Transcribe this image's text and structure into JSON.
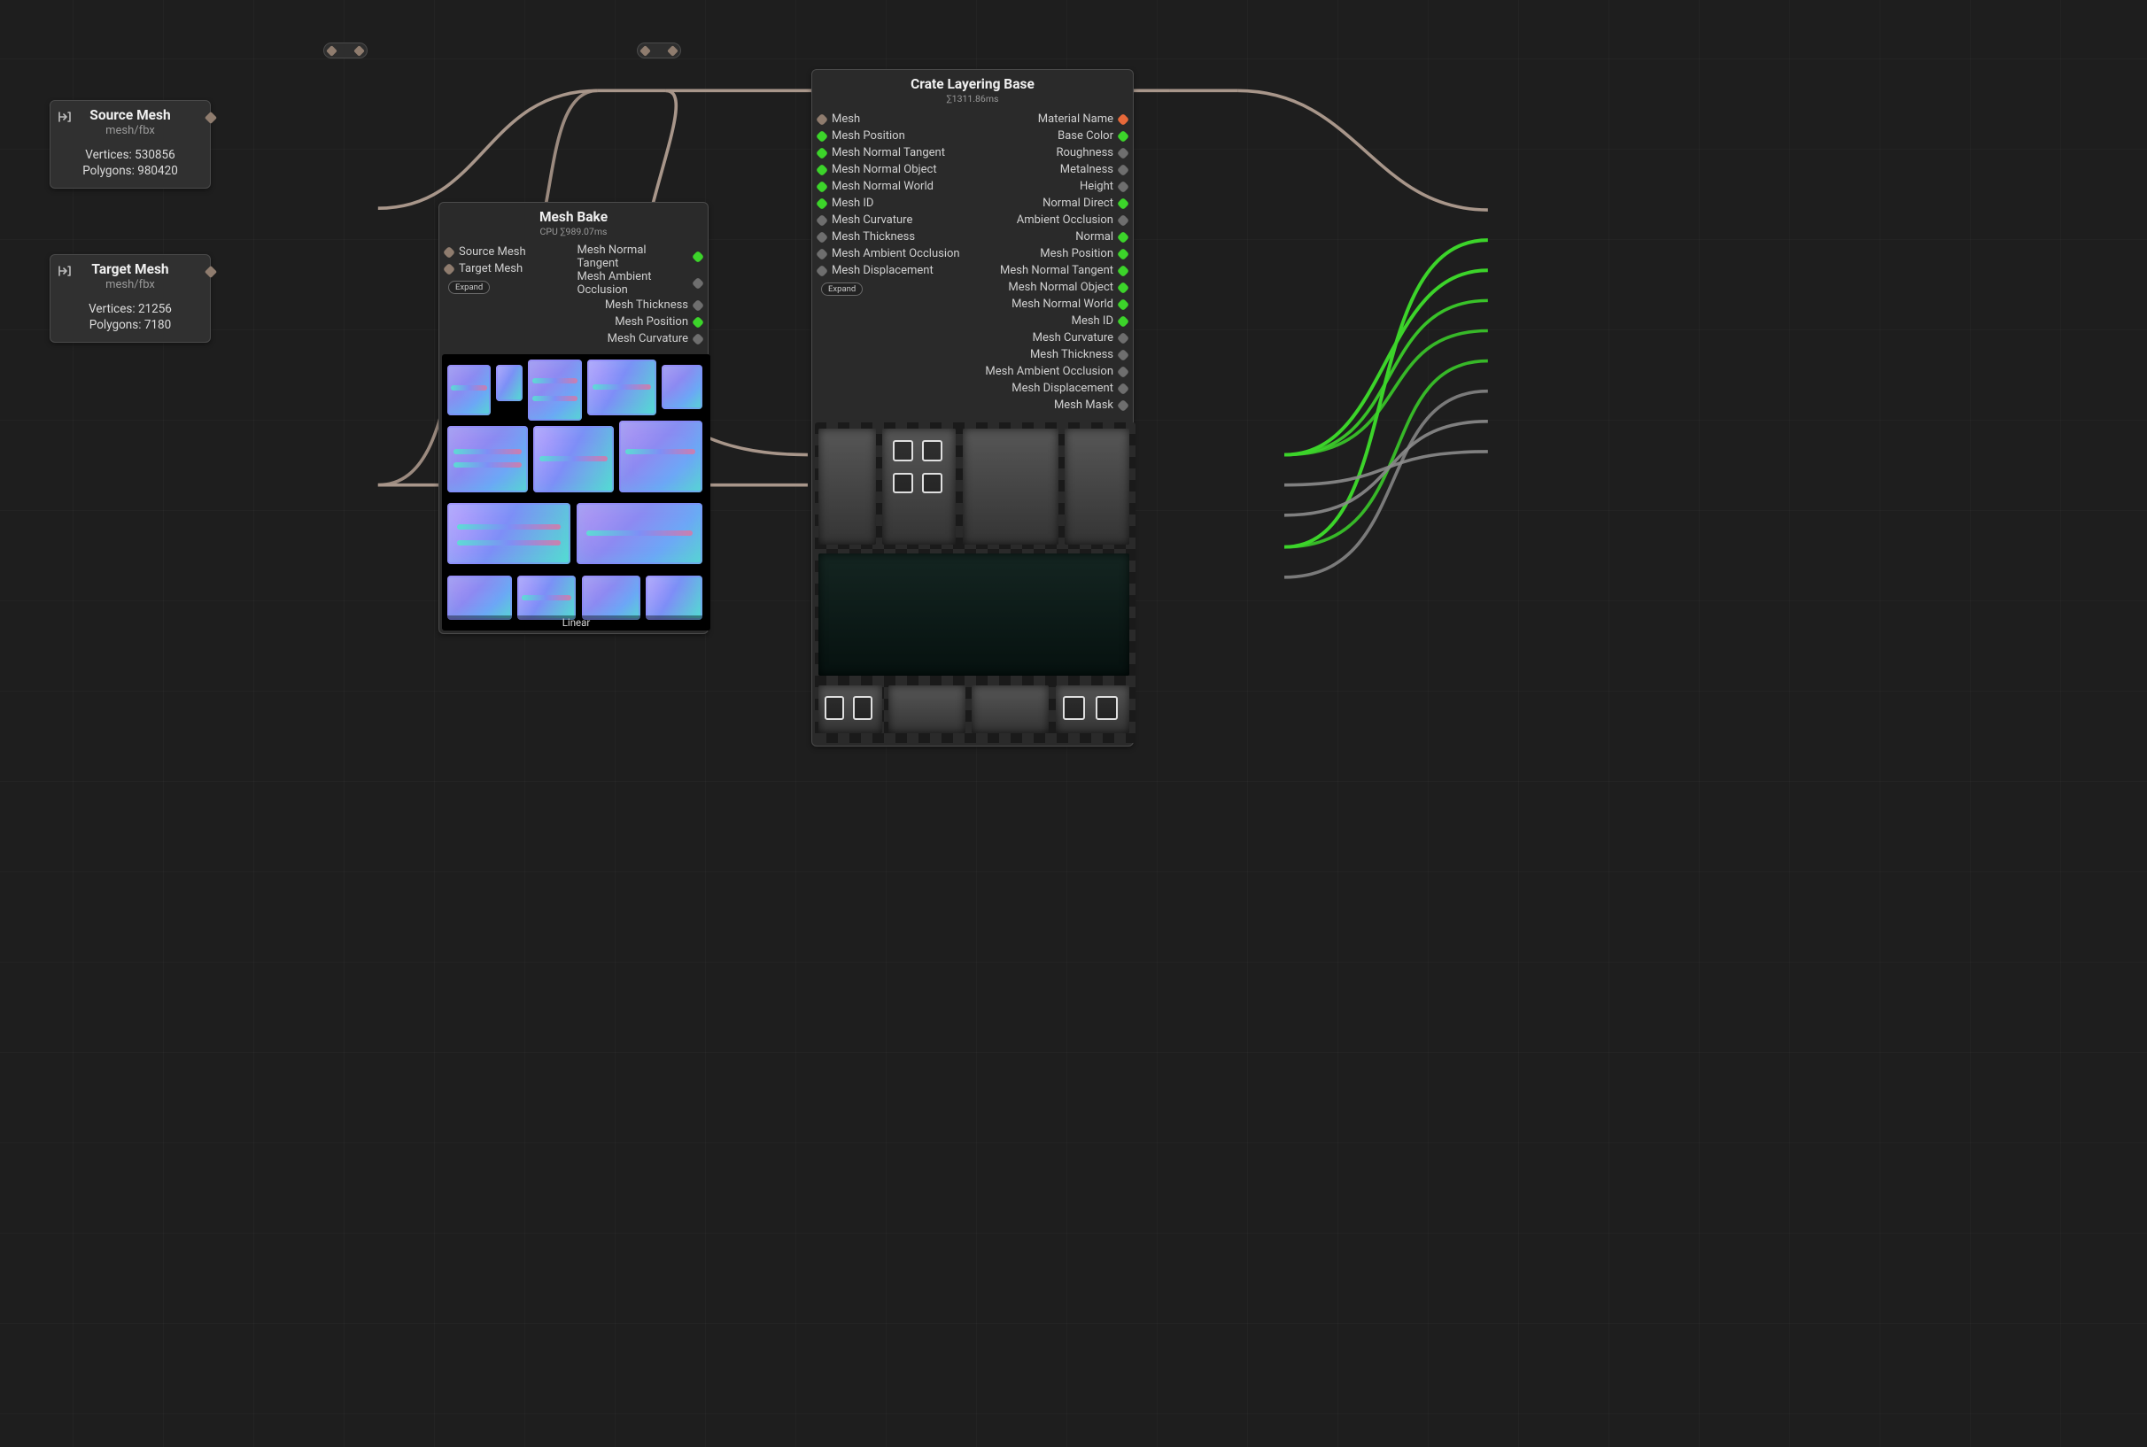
{
  "nodes": {
    "source": {
      "title": "Source Mesh",
      "subtitle": "mesh/fbx",
      "vertices_label": "Vertices: 530856",
      "polygons_label": "Polygons: 980420"
    },
    "target": {
      "title": "Target Mesh",
      "subtitle": "mesh/fbx",
      "vertices_label": "Vertices: 21256",
      "polygons_label": "Polygons: 7180"
    },
    "meshbake": {
      "title": "Mesh Bake",
      "meta": "CPU ∑989.07ms",
      "expand": "Expand",
      "inputs": [
        "Source Mesh",
        "Target Mesh"
      ],
      "outputs": [
        "Mesh Normal Tangent",
        "Mesh Ambient Occlusion",
        "Mesh Thickness",
        "Mesh Position",
        "Mesh Curvature"
      ],
      "output_colors": [
        "green",
        "gray",
        "gray",
        "green",
        "gray"
      ],
      "preview_label": "Linear"
    },
    "crate": {
      "title": "Crate Layering Base",
      "meta": "∑1311.86ms",
      "expand": "Expand",
      "inputs": [
        {
          "label": "Mesh",
          "color": "brown"
        },
        {
          "label": "Mesh Position",
          "color": "green"
        },
        {
          "label": "Mesh Normal Tangent",
          "color": "green"
        },
        {
          "label": "Mesh Normal Object",
          "color": "green"
        },
        {
          "label": "Mesh Normal World",
          "color": "green"
        },
        {
          "label": "Mesh ID",
          "color": "green"
        },
        {
          "label": "Mesh Curvature",
          "color": "gray"
        },
        {
          "label": "Mesh Thickness",
          "color": "gray"
        },
        {
          "label": "Mesh Ambient Occlusion",
          "color": "gray"
        },
        {
          "label": "Mesh Displacement",
          "color": "gray"
        }
      ],
      "outputs": [
        {
          "label": "Material Name",
          "color": "orange"
        },
        {
          "label": "Base Color",
          "color": "green"
        },
        {
          "label": "Roughness",
          "color": "gray"
        },
        {
          "label": "Metalness",
          "color": "gray"
        },
        {
          "label": "Height",
          "color": "gray"
        },
        {
          "label": "Normal Direct",
          "color": "green"
        },
        {
          "label": "Ambient Occlusion",
          "color": "gray"
        },
        {
          "label": "Normal",
          "color": "green"
        },
        {
          "label": "Mesh Position",
          "color": "green"
        },
        {
          "label": "Mesh Normal Tangent",
          "color": "green"
        },
        {
          "label": "Mesh Normal Object",
          "color": "green"
        },
        {
          "label": "Mesh Normal World",
          "color": "green"
        },
        {
          "label": "Mesh ID",
          "color": "green"
        },
        {
          "label": "Mesh Curvature",
          "color": "gray"
        },
        {
          "label": "Mesh Thickness",
          "color": "gray"
        },
        {
          "label": "Mesh Ambient Occlusion",
          "color": "gray"
        },
        {
          "label": "Mesh Displacement",
          "color": "gray"
        },
        {
          "label": "Mesh Mask",
          "color": "gray"
        }
      ]
    }
  },
  "wires": {
    "brown": "#a8968a",
    "green": "#3cd42a",
    "gray": "#7a7a7a"
  }
}
